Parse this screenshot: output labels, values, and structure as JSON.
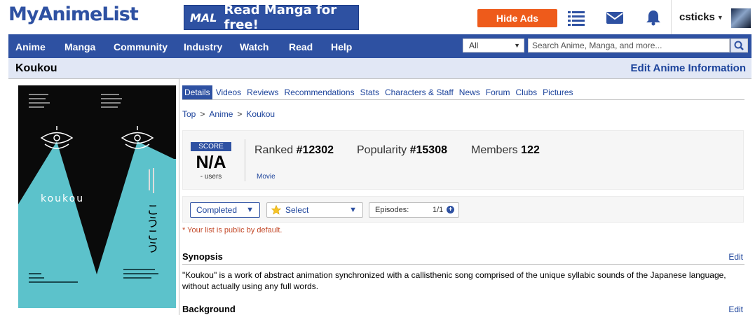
{
  "header": {
    "logo": "MyAnimeList",
    "banner_mal": "MAL",
    "banner_text": "Read Manga for free!",
    "hide_ads": "Hide Ads",
    "username": "csticks"
  },
  "nav": {
    "items": [
      "Anime",
      "Manga",
      "Community",
      "Industry",
      "Watch",
      "Read",
      "Help"
    ],
    "search_category": "All",
    "search_placeholder": "Search Anime, Manga, and more..."
  },
  "title_bar": {
    "title": "Koukou",
    "edit_link": "Edit Anime Information"
  },
  "poster": {
    "title_latin": "koukou",
    "title_kana": "こうこう"
  },
  "tabs": [
    "Details",
    "Videos",
    "Reviews",
    "Recommendations",
    "Stats",
    "Characters & Staff",
    "News",
    "Forum",
    "Clubs",
    "Pictures"
  ],
  "breadcrumb": [
    "Top",
    "Anime",
    "Koukou"
  ],
  "stats": {
    "score_label": "SCORE",
    "score_value": "N/A",
    "score_users": "- users",
    "ranked_label": "Ranked",
    "ranked_value": "#12302",
    "popularity_label": "Popularity",
    "popularity_value": "#15308",
    "members_label": "Members",
    "members_value": "122",
    "type": "Movie"
  },
  "list_controls": {
    "status": "Completed",
    "score_select": "Select",
    "episodes_label": "Episodes:",
    "episodes_value": "1/1",
    "public_note": "* Your list is public by default."
  },
  "synopsis": {
    "heading": "Synopsis",
    "edit": "Edit",
    "text": "\"Koukou\" is a work of abstract animation synchronized with a callisthenic song comprised of the unique syllabic sounds of the Japanese language, without actually using any full words."
  },
  "background": {
    "heading": "Background",
    "edit": "Edit"
  },
  "colors": {
    "brand_blue": "#2e51a2",
    "light_blue": "#e1e7f5",
    "hide_ads_orange": "#ee5b1b",
    "poster_teal": "#5cc2cb"
  }
}
